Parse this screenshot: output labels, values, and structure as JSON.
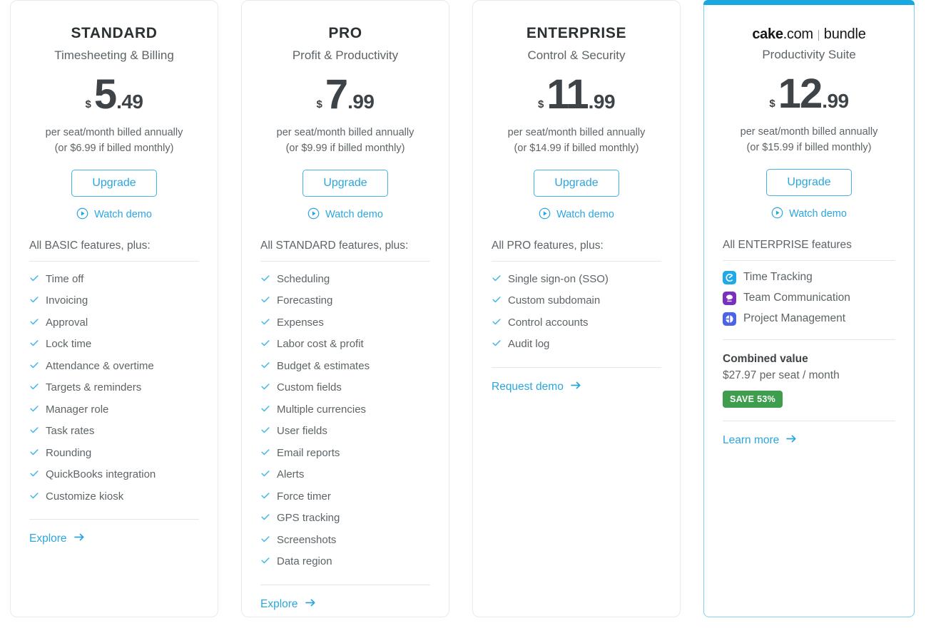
{
  "cards": [
    {
      "name": "STANDARD",
      "tagline": "Timesheeting & Billing",
      "currency": "$",
      "price_int": "5",
      "price_dec": ".49",
      "billing_line1": "per seat/month billed annually",
      "billing_line2": "(or $6.99 if billed monthly)",
      "cta_label": "Upgrade",
      "demo_label": "Watch demo",
      "features_head": "All BASIC features, plus:",
      "features": [
        "Time off",
        "Invoicing",
        "Approval",
        "Lock time",
        "Attendance & overtime",
        "Targets & reminders",
        "Manager role",
        "Task rates",
        "Rounding",
        "QuickBooks integration",
        "Customize kiosk"
      ],
      "link_label": "Explore"
    },
    {
      "name": "PRO",
      "tagline": "Profit & Productivity",
      "currency": "$",
      "price_int": "7",
      "price_dec": ".99",
      "billing_line1": "per seat/month billed annually",
      "billing_line2": "(or $9.99 if billed monthly)",
      "cta_label": "Upgrade",
      "demo_label": "Watch demo",
      "features_head": "All STANDARD features, plus:",
      "features": [
        "Scheduling",
        "Forecasting",
        "Expenses",
        "Labor cost & profit",
        "Budget & estimates",
        "Custom fields",
        "Multiple currencies",
        "User fields",
        "Email reports",
        "Alerts",
        "Force timer",
        "GPS tracking",
        "Screenshots",
        "Data region"
      ],
      "link_label": "Explore"
    },
    {
      "name": "ENTERPRISE",
      "tagline": "Control & Security",
      "currency": "$",
      "price_int": "11",
      "price_dec": ".99",
      "billing_line1": "per seat/month billed annually",
      "billing_line2": "(or $14.99 if billed monthly)",
      "cta_label": "Upgrade",
      "demo_label": "Watch demo",
      "features_head": "All PRO features, plus:",
      "features": [
        "Single sign-on (SSO)",
        "Custom subdomain",
        "Control accounts",
        "Audit log"
      ],
      "link_label": "Request demo"
    }
  ],
  "bundle": {
    "logo_cake": "cake",
    "logo_com": ".com",
    "logo_bundle": "bundle",
    "tagline": "Productivity Suite",
    "currency": "$",
    "price_int": "12",
    "price_dec": ".99",
    "billing_line1": "per seat/month billed annually",
    "billing_line2": "(or $15.99 if billed monthly)",
    "cta_label": "Upgrade",
    "demo_label": "Watch demo",
    "features_head": "All ENTERPRISE features",
    "products": [
      {
        "label": "Time Tracking",
        "icon": "clockify-icon",
        "color": "#1fa9e8"
      },
      {
        "label": "Team Communication",
        "icon": "pumble-icon",
        "color": "#7b2fbe"
      },
      {
        "label": "Project Management",
        "icon": "plaky-icon",
        "color": "#4a63e7"
      }
    ],
    "combined_title": "Combined value",
    "combined_value": "$27.97 per seat / month",
    "save_badge": "SAVE 53%",
    "link_label": "Learn more"
  },
  "colors": {
    "accent": "#2ba6dd",
    "top_bar": "#19a8e0",
    "badge_green": "#3f9e4d",
    "text_dark": "#3f4447",
    "text_muted": "#5d6468"
  },
  "icons": {
    "check": "check-icon",
    "play": "play-circle-icon",
    "arrow": "arrow-right-icon"
  }
}
